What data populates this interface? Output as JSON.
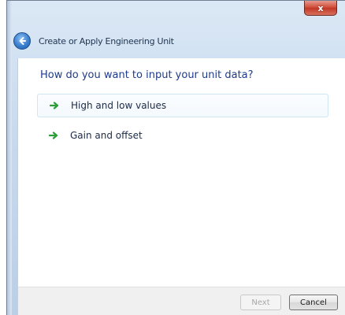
{
  "window": {
    "close_glyph": "x",
    "title": "Create or Apply Engineering Unit"
  },
  "nav": {
    "back_icon": "back-arrow-icon"
  },
  "main": {
    "question": "How do you want to input your unit data?",
    "options": [
      {
        "label": "High and low values",
        "icon": "green-arrow-icon",
        "highlighted": true
      },
      {
        "label": "Gain and offset",
        "icon": "green-arrow-icon",
        "highlighted": false
      }
    ]
  },
  "footer": {
    "next_label": "Next",
    "next_enabled": false,
    "cancel_label": "Cancel"
  },
  "colors": {
    "question_text": "#1e3a8a",
    "option_arrow": "#2e9e3a",
    "close_button": "#c13826",
    "back_button": "#3a7fcf"
  }
}
